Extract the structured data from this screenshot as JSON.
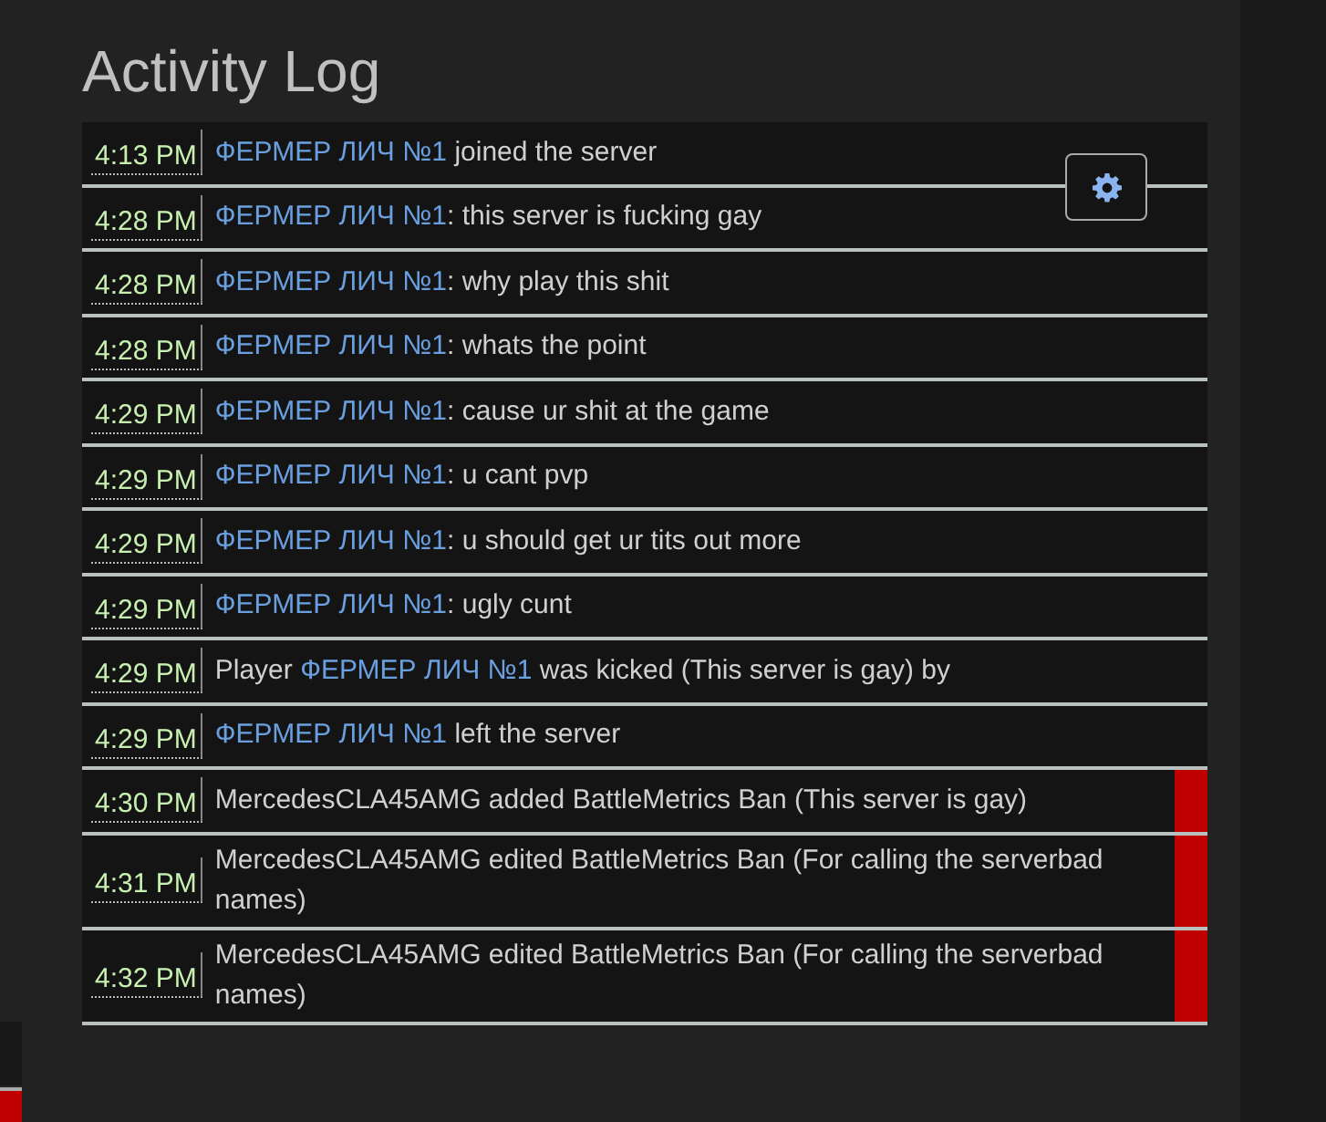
{
  "title": "Activity Log",
  "entries": [
    {
      "time": "4:13 PM",
      "flagged": false,
      "parts": [
        {
          "kind": "player",
          "text": "ФЕРМЕР ЛИЧ №1"
        },
        {
          "kind": "text",
          "text": " joined the server"
        }
      ]
    },
    {
      "time": "4:28 PM",
      "flagged": false,
      "parts": [
        {
          "kind": "player",
          "text": "ФЕРМЕР ЛИЧ №1"
        },
        {
          "kind": "text",
          "text": ": this server is fucking gay"
        }
      ]
    },
    {
      "time": "4:28 PM",
      "flagged": false,
      "parts": [
        {
          "kind": "player",
          "text": "ФЕРМЕР ЛИЧ №1"
        },
        {
          "kind": "text",
          "text": ": why play this shit"
        }
      ]
    },
    {
      "time": "4:28 PM",
      "flagged": false,
      "parts": [
        {
          "kind": "player",
          "text": "ФЕРМЕР ЛИЧ №1"
        },
        {
          "kind": "text",
          "text": ": whats the point"
        }
      ]
    },
    {
      "time": "4:29 PM",
      "flagged": false,
      "parts": [
        {
          "kind": "player",
          "text": "ФЕРМЕР ЛИЧ №1"
        },
        {
          "kind": "text",
          "text": ": cause ur shit at the game"
        }
      ]
    },
    {
      "time": "4:29 PM",
      "flagged": false,
      "parts": [
        {
          "kind": "player",
          "text": "ФЕРМЕР ЛИЧ №1"
        },
        {
          "kind": "text",
          "text": ": u cant pvp"
        }
      ]
    },
    {
      "time": "4:29 PM",
      "flagged": false,
      "parts": [
        {
          "kind": "player",
          "text": "ФЕРМЕР ЛИЧ №1"
        },
        {
          "kind": "text",
          "text": ": u should get ur tits out more"
        }
      ]
    },
    {
      "time": "4:29 PM",
      "flagged": false,
      "parts": [
        {
          "kind": "player",
          "text": "ФЕРМЕР ЛИЧ №1"
        },
        {
          "kind": "text",
          "text": ": ugly cunt"
        }
      ]
    },
    {
      "time": "4:29 PM",
      "flagged": false,
      "parts": [
        {
          "kind": "text",
          "text": "Player "
        },
        {
          "kind": "player",
          "text": "ФЕРМЕР ЛИЧ №1"
        },
        {
          "kind": "text",
          "text": " was kicked (This server is gay) by"
        }
      ]
    },
    {
      "time": "4:29 PM",
      "flagged": false,
      "parts": [
        {
          "kind": "player",
          "text": "ФЕРМЕР ЛИЧ №1"
        },
        {
          "kind": "text",
          "text": " left the server"
        }
      ]
    },
    {
      "time": "4:30 PM",
      "flagged": true,
      "parts": [
        {
          "kind": "text",
          "text": "MercedesCLA45AMG added BattleMetrics Ban (This server is gay)"
        }
      ]
    },
    {
      "time": "4:31 PM",
      "flagged": true,
      "parts": [
        {
          "kind": "text",
          "text": "MercedesCLA45AMG edited BattleMetrics Ban (For calling the serverbad names)"
        }
      ]
    },
    {
      "time": "4:32 PM",
      "flagged": true,
      "parts": [
        {
          "kind": "text",
          "text": "MercedesCLA45AMG edited BattleMetrics Ban (For calling the serverbad names)"
        }
      ]
    }
  ]
}
